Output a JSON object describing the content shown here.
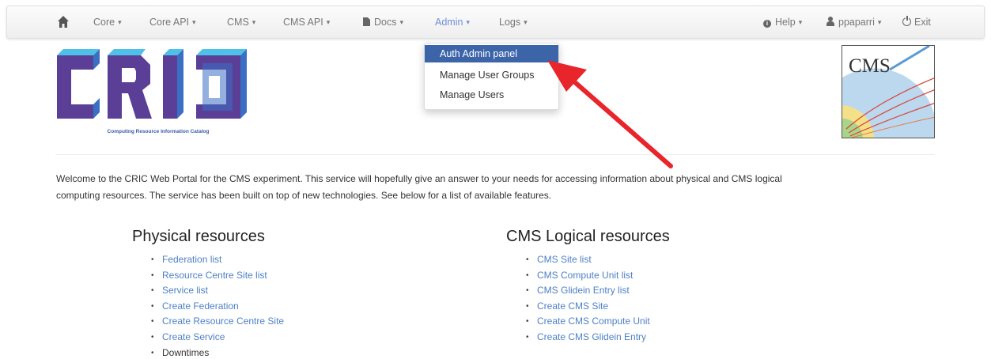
{
  "navbar": {
    "items": [
      {
        "label": "Core",
        "has_caret": true
      },
      {
        "label": "Core API",
        "has_caret": true
      },
      {
        "label": "CMS",
        "has_caret": true
      },
      {
        "label": "CMS API",
        "has_caret": true
      },
      {
        "label": "Docs",
        "has_caret": true
      },
      {
        "label": "Admin",
        "has_caret": true,
        "active": true
      },
      {
        "label": "Logs",
        "has_caret": true
      }
    ],
    "right": {
      "help": "Help",
      "user": "ppaparri",
      "exit": "Exit"
    },
    "caret_glyph": "▾",
    "icons": {
      "home": "home-icon",
      "docs": "file-icon",
      "help": "info-circle-icon",
      "user": "user-icon",
      "exit": "power-icon"
    }
  },
  "admin_dropdown": {
    "items": [
      {
        "label": "Auth Admin panel",
        "highlighted": true
      },
      {
        "label": "Manage User Groups"
      },
      {
        "label": "Manage Users"
      }
    ]
  },
  "cric_logo": {
    "tagline": "Computing Resource Information Catalog",
    "letters": "CRIC"
  },
  "cms_logo": {
    "text": "CMS"
  },
  "intro": {
    "line1": "Welcome to the CRIC Web Portal for the CMS experiment. This service will hopefully give an answer to your needs for accessing information about physical and CMS logical",
    "line2": "computing resources. The service has been built on top of new technologies. See below for a list of available features."
  },
  "physical": {
    "title": "Physical resources",
    "links": [
      "Federation list",
      "Resource Centre Site list",
      "Service list",
      "Create Federation",
      "Create Resource Centre Site",
      "Create Service"
    ],
    "plain": "Downtimes"
  },
  "logical": {
    "title": "CMS Logical resources",
    "links": [
      "CMS Site list",
      "CMS Compute Unit list",
      "CMS Glidein Entry list",
      "Create CMS Site",
      "Create CMS Compute Unit",
      "Create CMS Glidein Entry"
    ]
  },
  "colors": {
    "link": "#4f80c4",
    "active_nav": "#6f8fd8",
    "dropdown_highlight": "#3c64a8",
    "arrow": "#e8252b",
    "logo_purple": "#5b3f96",
    "logo_blue": "#3b6fc4",
    "logo_cyan": "#4fc0e8"
  }
}
